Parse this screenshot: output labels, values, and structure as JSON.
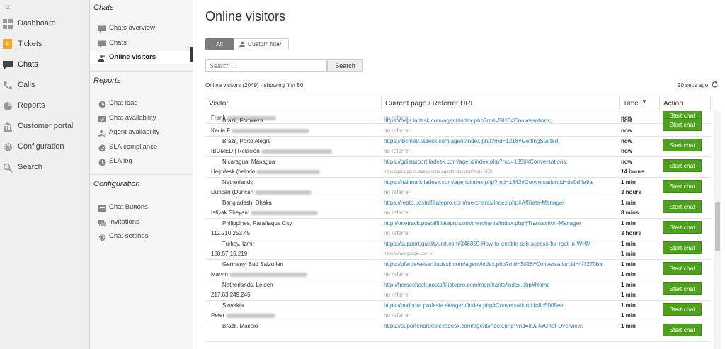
{
  "nav": {
    "items": [
      {
        "label": "Dashboard",
        "icon": "grid-icon"
      },
      {
        "label": "Tickets",
        "icon": "ticket-badge-icon",
        "badge": "4"
      },
      {
        "label": "Chats",
        "icon": "chat-bubble-icon"
      },
      {
        "label": "Calls",
        "icon": "phone-icon"
      },
      {
        "label": "Reports",
        "icon": "pie-chart-icon"
      },
      {
        "label": "Customer portal",
        "icon": "building-icon"
      },
      {
        "label": "Configuration",
        "icon": "gear-icon"
      },
      {
        "label": "Search",
        "icon": "search-icon"
      }
    ],
    "active": "Chats"
  },
  "subnav": {
    "chats_heading": "Chats",
    "chats_items": [
      "Chats overview",
      "Chats",
      "Online visitors"
    ],
    "reports_heading": "Reports",
    "reports_items": [
      "Chat load",
      "Chat availability",
      "Agent availability",
      "SLA compliance",
      "SLA log"
    ],
    "config_heading": "Configuration",
    "config_items": [
      "Chat Buttons",
      "Invitations",
      "Chat settings"
    ]
  },
  "main": {
    "title": "Online visitors",
    "filter_all": "All",
    "filter_custom": "Custom filter",
    "search_placeholder": "Search ...",
    "search_button": "Search",
    "summary": "Online visitors (2049) - showing first 50",
    "refresh": "20 secs ago",
    "headers": {
      "visitor": "Visitor",
      "page": "Current page / Referrer URL",
      "time": "Time",
      "action": "Action"
    },
    "rows": [
      {
        "loc": "",
        "visitor": "Frank",
        "url": "",
        "ref": "no referrer",
        "t1": "",
        "t2": "now",
        "btn": "Start chat"
      },
      {
        "loc": "Brazil, Fortaleza",
        "visitor": "Kecia F",
        "url": "https://naja.ladesk.com/agent/index.php?rnd=5813#Conversations;",
        "ref": "no referrer",
        "t1": "now",
        "t2": "now",
        "btn": "Start chat"
      },
      {
        "loc": "Brazil, Porto Alegre",
        "visitor": "IBCMED | Relacion",
        "url": "https://ibcmed.ladesk.com/agent/index.php?rnd=1218#GettingStarted;",
        "ref": "no referrer",
        "t1": "now",
        "t2": "now",
        "btn": "Start chat"
      },
      {
        "loc": "Nicaragua, Managua",
        "visitor": "Helpdesk (helpde",
        "url": "https://gdisupport.ladesk.com/agent/index.php?rnd=1350#Conversations;",
        "ref": "https://gdisupport.ladesk.com/ agent/index.php?rnd=1350",
        "ref_small": true,
        "t1": "now",
        "t2": "14 hours",
        "btn": "Start chat"
      },
      {
        "loc": "Netherlands",
        "visitor": "Duncan (Duncan",
        "url": "https://hallmark.ladesk.com/agent/index.php?rnd=1842#Conversation;id=da0d4a9a",
        "ref": "no referrer",
        "t1": "1 min",
        "t2": "3 hours",
        "btn": "Start chat"
      },
      {
        "loc": "Bangladesh, Dhaka",
        "visitor": "Istiyak Sheyam",
        "url": "https://repto.postaffiliatepro.com/merchants/index.php#Affiliate-Manager",
        "ref": "no referrer",
        "t1": "1 min",
        "t2": "8 mins",
        "btn": "Start chat"
      },
      {
        "loc": "Philippines, Parañaque City",
        "visitor": "112.210.253.45",
        "url": "http://onetrack.postaffiliatepro.com/merchants/index.php#Transaction-Manager",
        "ref": "no referrer",
        "t1": "1 min",
        "t2": "3 hours",
        "btn": "Start chat"
      },
      {
        "loc": "Turkey, Izmir",
        "visitor": "188.57.16.219",
        "url": "https://support.qualityunit.com/346859-How-to-enable-ssh-access-for-root-in-WHM",
        "ref": "https://www.google.com.tr/",
        "ref_small": true,
        "t1": "1 min",
        "t2": "1 min",
        "btn": "Start chat"
      },
      {
        "loc": "Germany, Bad Salzuflen",
        "visitor": "Marvin",
        "url": "https://pferdewetten.ladesk.com/agent/index.php?rnd=3026#Conversation;id=4f7270ba",
        "ref": "no referrer",
        "t1": "1 min",
        "t2": "1 min",
        "btn": "Start chat"
      },
      {
        "loc": "Netherlands, Leiden",
        "visitor": "217.63.249.245",
        "url": "http://horsecheck.postaffiliatepro.com/merchants/index.php#Home",
        "ref": "no referrer",
        "t1": "1 min",
        "t2": "1 min",
        "btn": "Start chat"
      },
      {
        "loc": "Slovakia",
        "visitor": "Peter",
        "url": "https://podpora.profesia.sk/agent/index.php#Conversation;id=8d5008ee",
        "ref": "no referrer",
        "t1": "1 min",
        "t2": "1 min",
        "btn": "Start chat"
      },
      {
        "loc": "Brazil, Maceio",
        "visitor": "",
        "url": "https://suportenordeste.ladesk.com/agent/index.php?rnd=8024#Chat-Overview;",
        "ref": "",
        "t1": "1 min",
        "t2": "",
        "btn": "Start chat"
      }
    ]
  }
}
